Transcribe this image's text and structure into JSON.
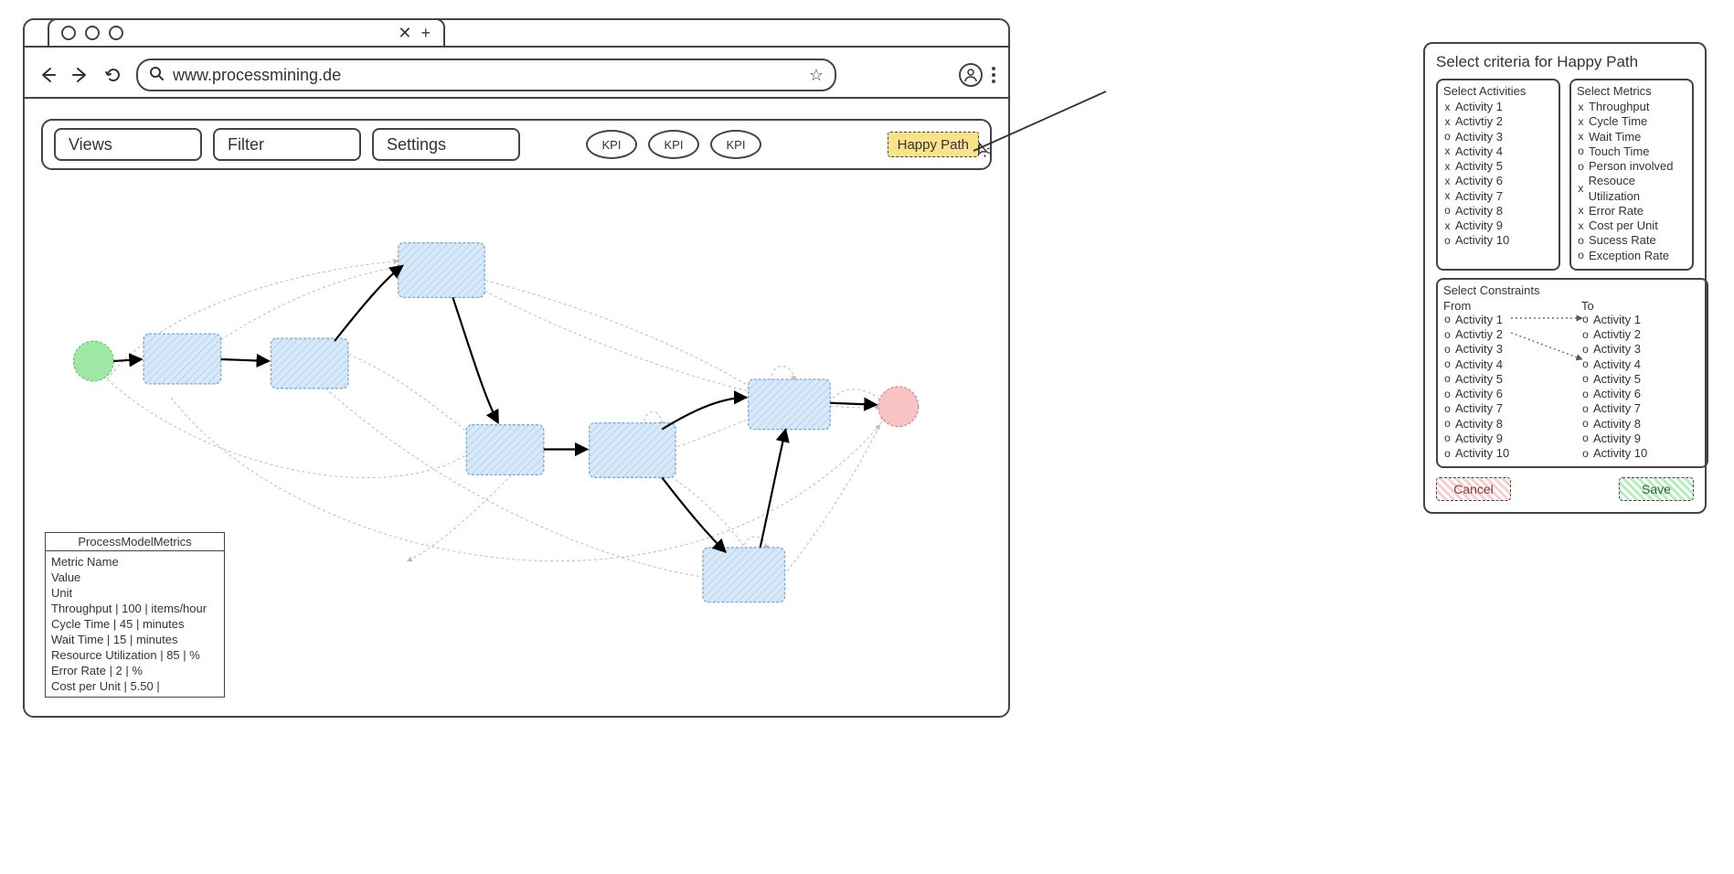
{
  "browser": {
    "tab_close": "✕",
    "tab_plus": "+",
    "url": "www.processmining.de",
    "star": "☆",
    "account_glyph": "⍟"
  },
  "toolbar": {
    "views_label": "Views",
    "filter_label": "Filter",
    "settings_label": "Settings",
    "kpi_label": "KPI",
    "happy_path_label": "Happy Path"
  },
  "metrics_panel": {
    "title": "ProcessModelMetrics",
    "rows": [
      "Metric Name",
      "Value",
      "Unit",
      "Throughput | 100 | items/hour",
      "Cycle Time | 45 | minutes",
      "Wait Time | 15 | minutes",
      "Resource Utilization | 85 | %",
      "Error Rate | 2 | %",
      "Cost per Unit | 5.50 |"
    ]
  },
  "popup": {
    "title": "Select criteria for Happy Path",
    "activities_title": "Select Activities",
    "activities": [
      {
        "sel": true,
        "label": "Activity 1"
      },
      {
        "sel": true,
        "label": "Activtiy 2"
      },
      {
        "sel": false,
        "label": "Activity 3"
      },
      {
        "sel": true,
        "label": "Activity 4"
      },
      {
        "sel": true,
        "label": "Activity 5"
      },
      {
        "sel": true,
        "label": "Activity 6"
      },
      {
        "sel": true,
        "label": "Activity 7"
      },
      {
        "sel": false,
        "label": "Activity 8"
      },
      {
        "sel": true,
        "label": "Activity 9"
      },
      {
        "sel": false,
        "label": "Activity 10"
      }
    ],
    "metrics_title": "Select Metrics",
    "metrics": [
      {
        "sel": true,
        "label": "Throughput"
      },
      {
        "sel": true,
        "label": "Cycle Time"
      },
      {
        "sel": true,
        "label": "Wait Time"
      },
      {
        "sel": false,
        "label": "Touch Time"
      },
      {
        "sel": false,
        "label": "Person involved"
      },
      {
        "sel": true,
        "label": "Resouce Utilization"
      },
      {
        "sel": true,
        "label": "Error Rate"
      },
      {
        "sel": true,
        "label": "Cost per Unit"
      },
      {
        "sel": false,
        "label": "Sucess Rate"
      },
      {
        "sel": false,
        "label": "Exception Rate"
      }
    ],
    "constraints_title": "Select Constraints",
    "from_label": "From",
    "to_label": "To",
    "from_items": [
      {
        "sel": false,
        "label": "Activity 1"
      },
      {
        "sel": false,
        "label": "Activtiy 2"
      },
      {
        "sel": false,
        "label": "Activity 3"
      },
      {
        "sel": false,
        "label": "Activity 4"
      },
      {
        "sel": false,
        "label": "Activity 5"
      },
      {
        "sel": false,
        "label": "Activity 6"
      },
      {
        "sel": false,
        "label": "Activity 7"
      },
      {
        "sel": false,
        "label": "Activity 8"
      },
      {
        "sel": false,
        "label": "Activity 9"
      },
      {
        "sel": false,
        "label": "Activity 10"
      }
    ],
    "to_items": [
      {
        "sel": false,
        "label": "Activity 1"
      },
      {
        "sel": false,
        "label": "Activtiy 2"
      },
      {
        "sel": false,
        "label": "Activity 3"
      },
      {
        "sel": false,
        "label": "Activity 4"
      },
      {
        "sel": false,
        "label": "Activity 5"
      },
      {
        "sel": false,
        "label": "Activity 6"
      },
      {
        "sel": false,
        "label": "Activity 7"
      },
      {
        "sel": false,
        "label": "Activity 8"
      },
      {
        "sel": false,
        "label": "Activity 9"
      },
      {
        "sel": false,
        "label": "Activity 10"
      }
    ],
    "cancel_label": "Cancel",
    "save_label": "Save"
  }
}
